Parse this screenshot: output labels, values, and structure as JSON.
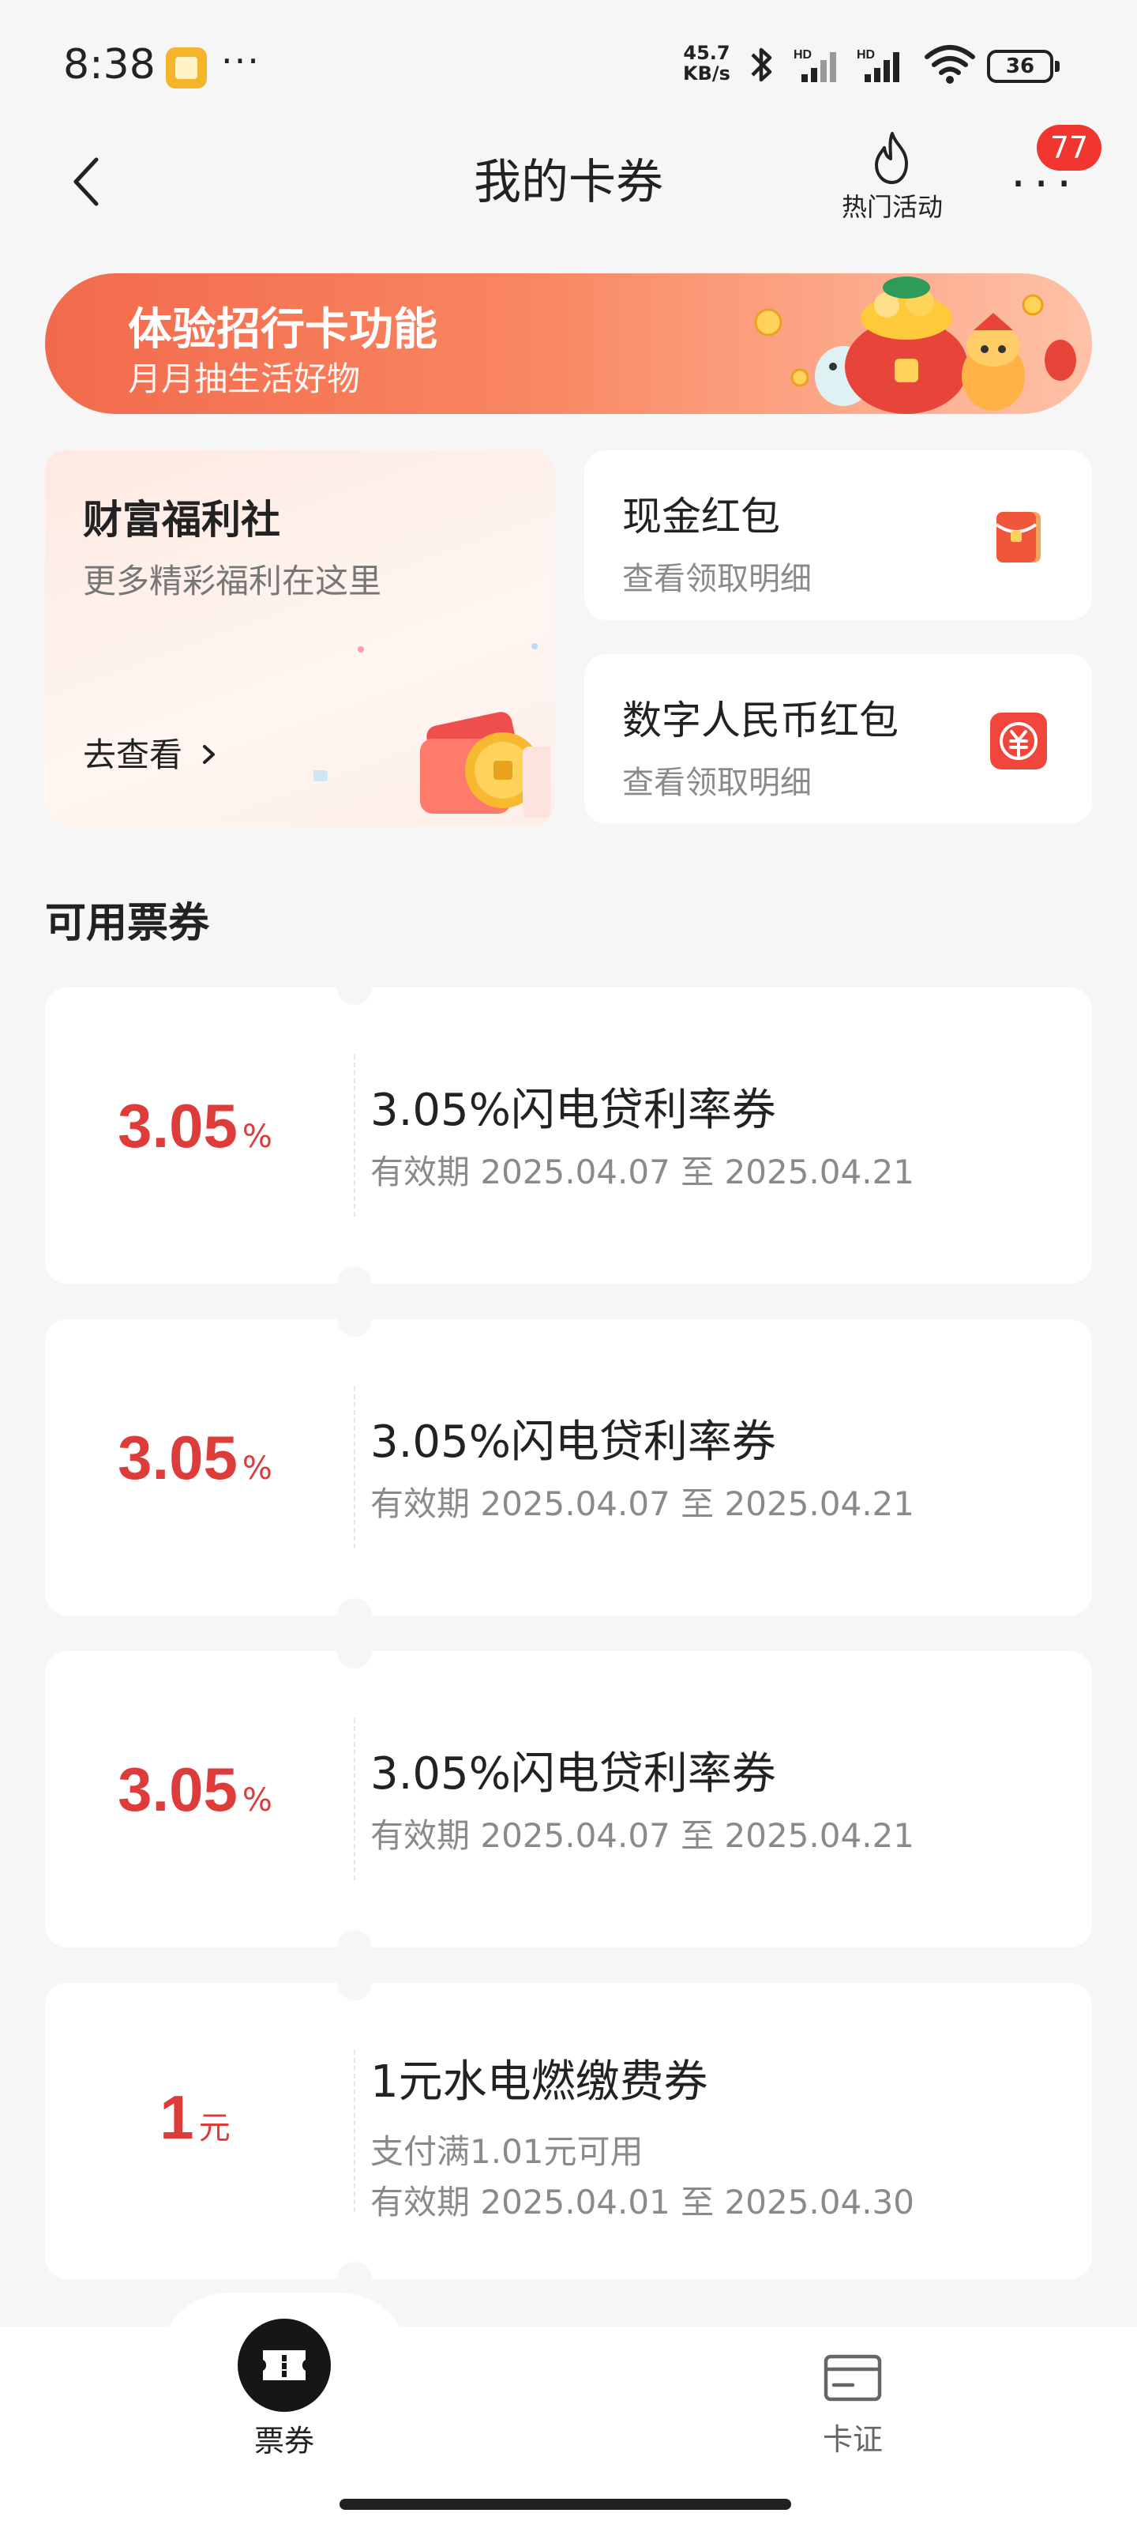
{
  "status_bar": {
    "time": "8:38",
    "more": "···",
    "net_speed_value": "45.7",
    "net_speed_unit": "KB/s",
    "battery": "36",
    "icons": [
      "gallery-app-icon",
      "bluetooth-icon",
      "signal-hd-icon",
      "signal-hd-icon",
      "wifi-icon",
      "battery-icon"
    ]
  },
  "header": {
    "title": "我的卡券",
    "hot_activity_label": "热门活动",
    "badge_count": "77"
  },
  "banner": {
    "title": "体验招行卡功能",
    "subtitle": "月月抽生活好物"
  },
  "wealth_card": {
    "title": "财富福利社",
    "subtitle": "更多精彩福利在这里",
    "link": "去查看"
  },
  "red_packets": [
    {
      "title": "现金红包",
      "subtitle": "查看领取明细",
      "icon": "red-packet-icon"
    },
    {
      "title": "数字人民币红包",
      "subtitle": "查看领取明细",
      "icon": "digital-rmb-icon"
    }
  ],
  "section_title": "可用票券",
  "coupons": [
    {
      "amount": "3.05",
      "unit": "%",
      "title": "3.05%闪电贷利率券",
      "lines": [
        "有效期 2025.04.07 至 2025.04.21"
      ]
    },
    {
      "amount": "3.05",
      "unit": "%",
      "title": "3.05%闪电贷利率券",
      "lines": [
        "有效期 2025.04.07 至 2025.04.21"
      ]
    },
    {
      "amount": "3.05",
      "unit": "%",
      "title": "3.05%闪电贷利率券",
      "lines": [
        "有效期 2025.04.07 至 2025.04.21"
      ]
    },
    {
      "amount": "1",
      "unit": "元",
      "title": "1元水电燃缴费券",
      "lines": [
        "支付满1.01元可用",
        "有效期 2025.04.01 至 2025.04.30"
      ]
    }
  ],
  "bottom_nav": [
    {
      "label": "票券",
      "active": true,
      "icon": "ticket-icon"
    },
    {
      "label": "卡证",
      "active": false,
      "icon": "card-icon"
    }
  ],
  "colors": {
    "accent_red": "#de3b3b",
    "badge_red": "#f0362f",
    "banner_start": "#f26a4d"
  }
}
